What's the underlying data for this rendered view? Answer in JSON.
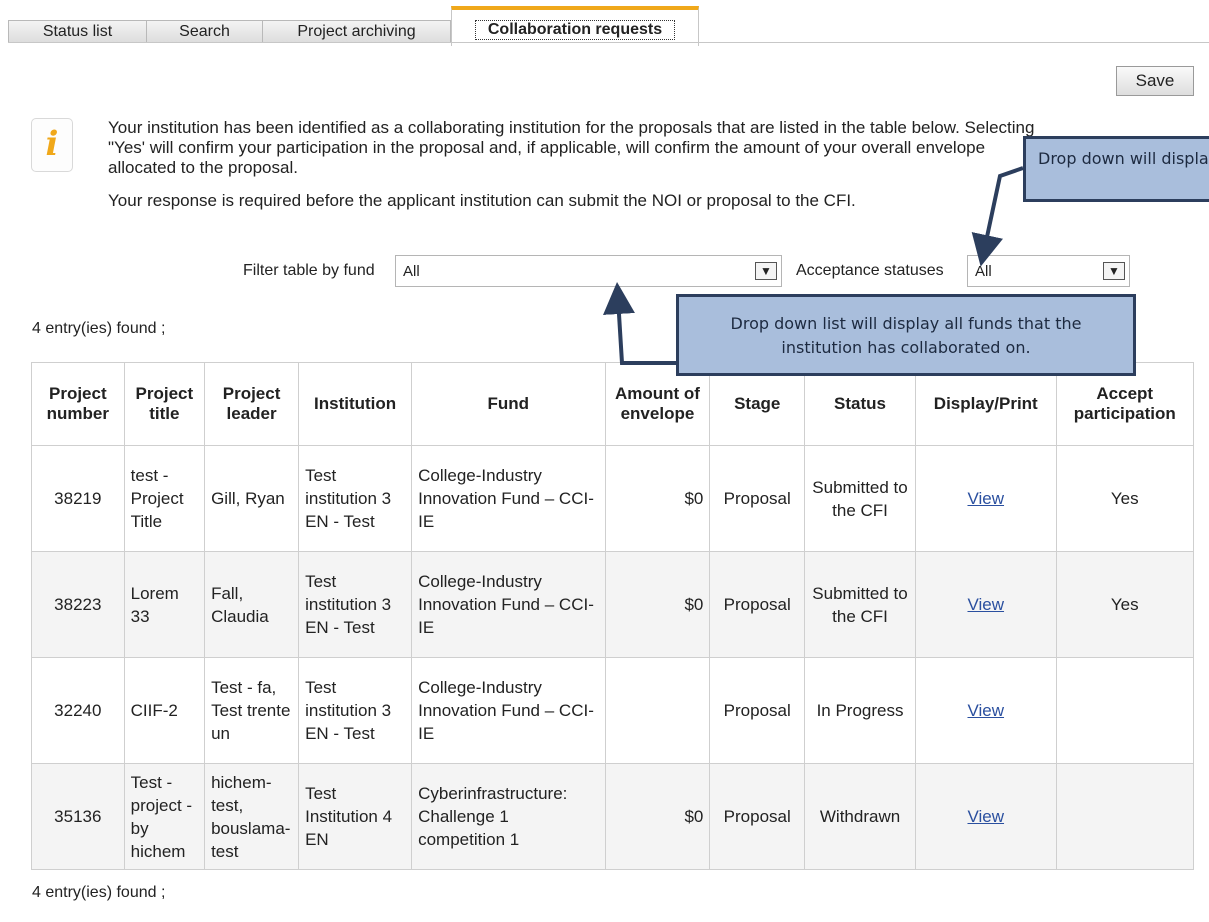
{
  "tabs": [
    "Status list",
    "Search",
    "Project archiving",
    "Collaboration requests"
  ],
  "toolbar": {
    "save_label": "Save"
  },
  "info": {
    "icon": "i",
    "paragraph1": "Your institution has been identified as a collaborating institution for the proposals that are listed in the table below. Selecting \"Yes' will confirm your participation in the proposal and, if applicable, will confirm the amount of your overall envelope allocated to the proposal.",
    "paragraph2": "Your response is required before the applicant institution can submit the NOI or proposal to the CFI."
  },
  "filters": {
    "fund_label": "Filter table by fund",
    "fund_value": "All",
    "acceptance_label": "Acceptance statuses",
    "acceptance_value": "All"
  },
  "count_text": "4 entry(ies) found ;",
  "table": {
    "headers": [
      "Project number",
      "Project title",
      "Project leader",
      "Institution",
      "Fund",
      "Amount of envelope",
      "Stage",
      "Status",
      "Display/Print",
      "Accept participation"
    ],
    "rows": [
      {
        "number": "38219",
        "title": "test - Project Title",
        "leader": "Gill, Ryan",
        "institution": "Test institution 3 EN - Test",
        "fund": "College-Industry Innovation Fund – CCI-IE",
        "amount": "$0",
        "stage": "Proposal",
        "status": "Submitted to the CFI",
        "display": "View",
        "accept": "Yes"
      },
      {
        "number": "38223",
        "title": "Lorem 33",
        "leader": "Fall, Claudia",
        "institution": "Test institution 3 EN - Test",
        "fund": "College-Industry Innovation Fund – CCI-IE",
        "amount": "$0",
        "stage": "Proposal",
        "status": "Submitted to the CFI",
        "display": "View",
        "accept": "Yes"
      },
      {
        "number": "32240",
        "title": "CIIF-2",
        "leader": "Test - fa, Test trente un",
        "institution": "Test institution 3 EN - Test",
        "fund": "College-Industry Innovation Fund – CCI-IE",
        "amount": "",
        "stage": "Proposal",
        "status": "In Progress",
        "display": "View",
        "accept": ""
      },
      {
        "number": "35136",
        "title": "Test - project - by hichem",
        "leader": "hichem-test, bouslama-test",
        "institution": "Test Institution 4 EN",
        "fund": "Cyberinfrastructure: Challenge 1 competition 1",
        "amount": "$0",
        "stage": "Proposal",
        "status": "Withdrawn",
        "display": "View",
        "accept": ""
      }
    ]
  },
  "callouts": {
    "top_right": "Drop down will display the institution",
    "fund": "Drop down list will display all funds that the institution has collaborated on."
  },
  "colors": {
    "tab_accent": "#f0a81a",
    "callout_fill": "#a9bedc",
    "callout_border": "#2c3e5d",
    "link": "#2a4f9f"
  }
}
